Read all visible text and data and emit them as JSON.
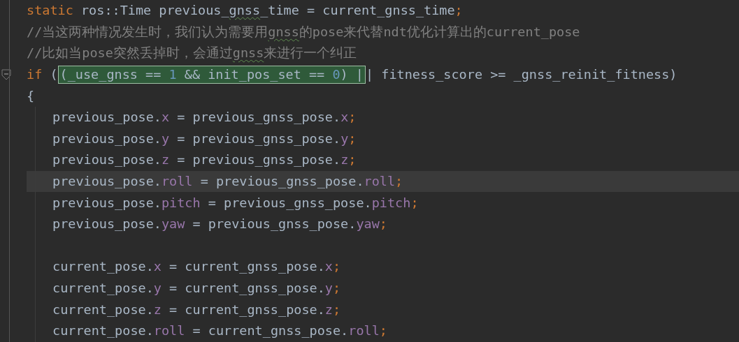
{
  "lines": [
    {
      "current": false,
      "tokens": [
        {
          "text": "static",
          "kind": "keyword"
        },
        {
          "text": " ros::Time previous_",
          "kind": "plain"
        },
        {
          "text": "gnss",
          "kind": "typo"
        },
        {
          "text": "_time = current_gnss_time",
          "kind": "plain"
        },
        {
          "text": ";",
          "kind": "punct"
        }
      ]
    },
    {
      "current": false,
      "tokens": [
        {
          "text": "//当这两种情况发生时，我们认为需要用",
          "kind": "comment"
        },
        {
          "text": "gnss",
          "kind": "comment_typo"
        },
        {
          "text": "的pose来代替ndt优化计算出的current_pose",
          "kind": "comment"
        }
      ]
    },
    {
      "current": false,
      "tokens": [
        {
          "text": "//比如当pose突然丢掉时，会通过",
          "kind": "comment"
        },
        {
          "text": "gnss",
          "kind": "comment_typo"
        },
        {
          "text": "来进行一个纠正",
          "kind": "comment"
        }
      ]
    },
    {
      "current": false,
      "fold": true,
      "tokens": [
        {
          "text": "if",
          "kind": "keyword"
        },
        {
          "text": " (",
          "kind": "plain"
        },
        {
          "kind": "highlight",
          "tokens": [
            {
              "text": "(_use_gnss == ",
              "kind": "plain"
            },
            {
              "text": "1",
              "kind": "number"
            },
            {
              "text": " && init_pos_set == ",
              "kind": "plain"
            },
            {
              "text": "0",
              "kind": "number"
            },
            {
              "text": ") |",
              "kind": "plain"
            }
          ]
        },
        {
          "text": "| fitness_score >= _gnss_reinit_fitness)",
          "kind": "plain"
        }
      ]
    },
    {
      "current": false,
      "tokens": [
        {
          "text": "{",
          "kind": "plain"
        }
      ],
      "children": [
        {
          "current": false,
          "tokens": [
            {
              "text": "previous_pose.",
              "kind": "plain"
            },
            {
              "text": "x",
              "kind": "field"
            },
            {
              "text": " = previous_gnss_pose.",
              "kind": "plain"
            },
            {
              "text": "x",
              "kind": "field"
            },
            {
              "text": ";",
              "kind": "punct"
            }
          ]
        },
        {
          "current": false,
          "tokens": [
            {
              "text": "previous_pose.",
              "kind": "plain"
            },
            {
              "text": "y",
              "kind": "field"
            },
            {
              "text": " = previous_gnss_pose.",
              "kind": "plain"
            },
            {
              "text": "y",
              "kind": "field"
            },
            {
              "text": ";",
              "kind": "punct"
            }
          ]
        },
        {
          "current": false,
          "tokens": [
            {
              "text": "previous_pose.",
              "kind": "plain"
            },
            {
              "text": "z",
              "kind": "field"
            },
            {
              "text": " = previous_gnss_pose.",
              "kind": "plain"
            },
            {
              "text": "z",
              "kind": "field"
            },
            {
              "text": ";",
              "kind": "punct"
            }
          ]
        },
        {
          "current": true,
          "tokens": [
            {
              "text": "previous_pose.",
              "kind": "plain"
            },
            {
              "text": "roll",
              "kind": "field"
            },
            {
              "text": " = previous_gnss_pose.",
              "kind": "plain"
            },
            {
              "text": "roll",
              "kind": "field"
            },
            {
              "text": ";",
              "kind": "punct"
            }
          ]
        },
        {
          "current": false,
          "tokens": [
            {
              "text": "previous_pose.",
              "kind": "plain"
            },
            {
              "text": "pitch",
              "kind": "field"
            },
            {
              "text": " = previous_gnss_pose.",
              "kind": "plain"
            },
            {
              "text": "pitch",
              "kind": "field"
            },
            {
              "text": ";",
              "kind": "punct"
            }
          ]
        },
        {
          "current": false,
          "tokens": [
            {
              "text": "previous_pose.",
              "kind": "plain"
            },
            {
              "text": "yaw",
              "kind": "field"
            },
            {
              "text": " = previous_gnss_pose.",
              "kind": "plain"
            },
            {
              "text": "yaw",
              "kind": "field"
            },
            {
              "text": ";",
              "kind": "punct"
            }
          ]
        },
        {
          "current": false
        },
        {
          "current": false,
          "tokens": [
            {
              "text": "current_pose.",
              "kind": "plain"
            },
            {
              "text": "x",
              "kind": "field"
            },
            {
              "text": " = current_gnss_pose.",
              "kind": "plain"
            },
            {
              "text": "x",
              "kind": "field"
            },
            {
              "text": ";",
              "kind": "punct"
            }
          ]
        },
        {
          "current": false,
          "tokens": [
            {
              "text": "current_pose.",
              "kind": "plain"
            },
            {
              "text": "y",
              "kind": "field"
            },
            {
              "text": " = current_gnss_pose.",
              "kind": "plain"
            },
            {
              "text": "y",
              "kind": "field"
            },
            {
              "text": ";",
              "kind": "punct"
            }
          ]
        },
        {
          "current": false,
          "tokens": [
            {
              "text": "current_pose.",
              "kind": "plain"
            },
            {
              "text": "z",
              "kind": "field"
            },
            {
              "text": " = current_gnss_pose.",
              "kind": "plain"
            },
            {
              "text": "z",
              "kind": "field"
            },
            {
              "text": ";",
              "kind": "punct"
            }
          ]
        },
        {
          "current": false,
          "tokens": [
            {
              "text": "current_pose.",
              "kind": "plain"
            },
            {
              "text": "roll",
              "kind": "field"
            },
            {
              "text": " = current_gnss_pose.",
              "kind": "plain"
            },
            {
              "text": "roll",
              "kind": "field"
            },
            {
              "text": ";",
              "kind": "punct"
            }
          ]
        }
      ]
    }
  ]
}
